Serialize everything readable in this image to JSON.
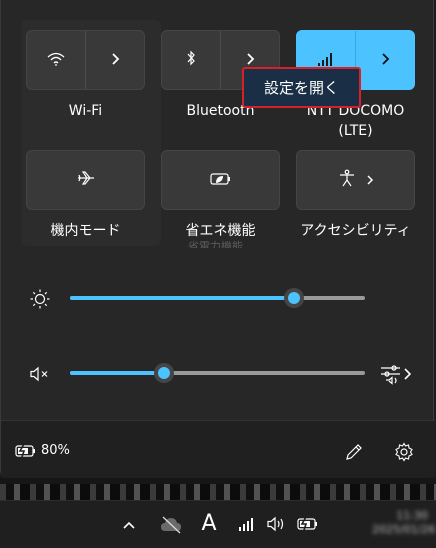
{
  "quick_settings": {
    "tiles": [
      {
        "id": "wifi",
        "label": "Wi-Fi",
        "icon": "wifi-icon",
        "active": false
      },
      {
        "id": "bluetooth",
        "label": "Bluetooth",
        "icon": "bluetooth-icon",
        "active": false
      },
      {
        "id": "cellular",
        "label": "NTT DOCOMO",
        "sublabel": "(LTE)",
        "icon": "cellular-signal-icon",
        "active": true
      },
      {
        "id": "airplane",
        "label": "機内モード",
        "icon": "airplane-icon",
        "active": false
      },
      {
        "id": "battery_saver",
        "label": "省エネ機能",
        "icon": "battery-saver-icon",
        "active": false
      },
      {
        "id": "accessibility",
        "label": "アクセシビリティ",
        "icon": "accessibility-icon",
        "active": false
      }
    ],
    "tooltip": "設定を開く",
    "ghost_text": "省電力機能",
    "brightness": {
      "icon": "brightness-sun-icon",
      "level": 0.76
    },
    "volume": {
      "icon": "speaker-muted-icon",
      "level": 0.32,
      "output_icon": "audio-output-select-icon"
    },
    "footer": {
      "battery_percent": "80%",
      "battery_icon": "battery-charging-icon",
      "edit_icon": "pencil-icon",
      "settings_icon": "gear-icon"
    }
  },
  "accent_color": "#4cc2ff",
  "tooltip_border_color": "#d7202a",
  "taskbar": {
    "icons": [
      "chevron-up-icon",
      "cloud-off-icon",
      "ime-mode-icon",
      "cellular-signal-icon",
      "speaker-icon",
      "battery-charging-icon"
    ],
    "ime_label": "A",
    "clock_time": "11:30",
    "clock_date": "2025/01/26"
  }
}
